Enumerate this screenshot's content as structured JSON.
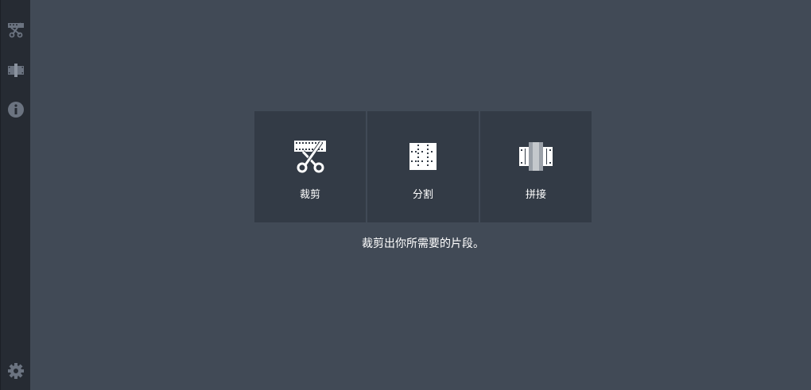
{
  "sidebar": {
    "items": [
      {
        "name": "trim-nav-icon"
      },
      {
        "name": "join-nav-icon"
      },
      {
        "name": "info-icon"
      },
      {
        "name": "settings-icon"
      }
    ]
  },
  "main": {
    "cards": [
      {
        "label": "裁剪",
        "icon": "scissors-film-icon"
      },
      {
        "label": "分割",
        "icon": "grid-split-icon"
      },
      {
        "label": "拼接",
        "icon": "film-join-icon"
      }
    ],
    "description": "裁剪出你所需要的片段。"
  },
  "colors": {
    "background": "#414a56",
    "sidebar": "#262b33",
    "card": "#333b46",
    "sidebar_icon": "#6b7380"
  }
}
